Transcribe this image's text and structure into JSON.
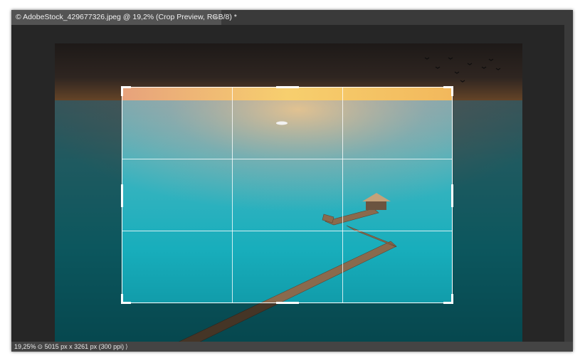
{
  "document_tab": {
    "title": "© AdobeStock_429677326.jpeg @ 19,2% (Crop Preview, RGB/8) *",
    "close_glyph": "×"
  },
  "status_bar": {
    "zoom": "19,25%",
    "separator": "⊙",
    "doc_info": "5015 px x 3261 px (300 ppi)",
    "menu_arrow": "⟩"
  },
  "crop": {
    "grid": "rule-of-thirds",
    "handle_color": "#ffffff"
  },
  "colors": {
    "workspace": "#262626",
    "panel": "#535353",
    "tabbar": "#3a3a3a",
    "sea": "#1aa7b5",
    "sunset": "#f4b25a"
  }
}
